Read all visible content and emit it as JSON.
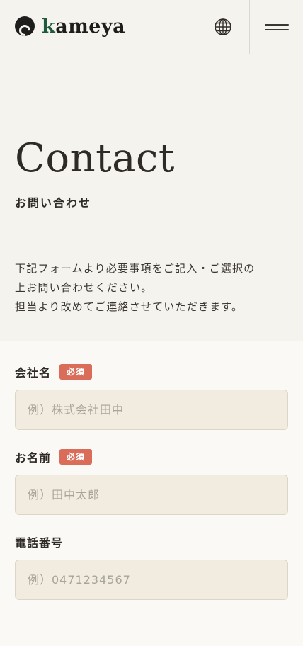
{
  "header": {
    "logo_text": "kameya",
    "globe_icon": "globe-icon",
    "menu_icon": "hamburger-menu-icon"
  },
  "hero": {
    "title": "Contact",
    "subtitle": "お問い合わせ",
    "description": [
      "下記フォームより必要事項をご記入・ご選択の",
      "上お問い合わせください。",
      "担当より改めてご連絡させていただきます。"
    ]
  },
  "form": {
    "required_badge": "必須",
    "fields": [
      {
        "label": "会社名",
        "required": true,
        "placeholder": "例）株式会社田中"
      },
      {
        "label": "お名前",
        "required": true,
        "placeholder": "例）田中太郎"
      },
      {
        "label": "電話番号",
        "required": false,
        "placeholder": "例）0471234567"
      }
    ]
  },
  "colors": {
    "background": "#f5f3ed",
    "form_background": "#faf9f6",
    "input_background": "#f1ecdf",
    "required_badge": "#d96d5a",
    "logo_accent": "#1f5a3e"
  }
}
